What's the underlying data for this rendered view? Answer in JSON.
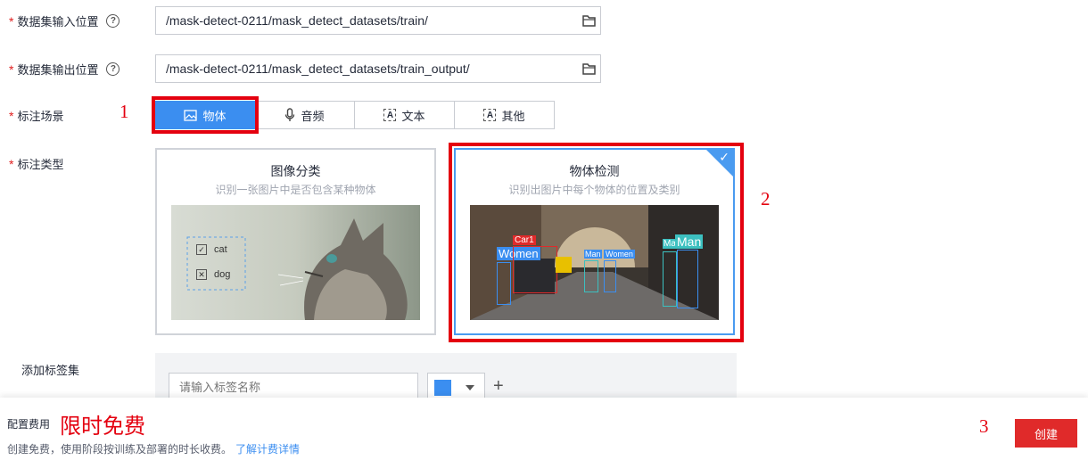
{
  "form": {
    "input_location": {
      "required_mark": "*",
      "label": "数据集输入位置",
      "help_icon": "question-circle-icon",
      "value": "/mask-detect-0211/mask_detect_datasets/train/",
      "icon": "folder-icon"
    },
    "output_location": {
      "required_mark": "*",
      "label": "数据集输出位置",
      "help_icon": "question-circle-icon",
      "value": "/mask-detect-0211/mask_detect_datasets/train_output/",
      "icon": "folder-icon"
    },
    "scene": {
      "required_mark": "*",
      "label": "标注场景",
      "options": [
        {
          "label": "物体",
          "icon": "image-icon",
          "selected": true
        },
        {
          "label": "音频",
          "icon": "microphone-icon",
          "selected": false
        },
        {
          "label": "文本",
          "icon": "text-icon",
          "selected": false
        },
        {
          "label": "其他",
          "icon": "text-icon",
          "selected": false
        }
      ]
    },
    "type": {
      "required_mark": "*",
      "label": "标注类型",
      "cards": [
        {
          "title": "图像分类",
          "subtitle": "识别一张图片中是否包含某种物体",
          "selected": false,
          "labels": [
            {
              "text": "cat",
              "checked": true
            },
            {
              "text": "dog",
              "checked": false
            }
          ]
        },
        {
          "title": "物体检测",
          "subtitle": "识别出图片中每个物体的位置及类别",
          "selected": true,
          "boxes": [
            "Car1",
            "Women",
            "Man",
            "Women",
            "Ma",
            "Man"
          ]
        }
      ]
    },
    "tags": {
      "label": "添加标签集",
      "input_placeholder": "请输入标签名称",
      "color": "#3b8ef0",
      "add_symbol": "+"
    }
  },
  "annotations": {
    "mark1": "1",
    "mark2": "2",
    "mark3": "3",
    "color": "#e4000f"
  },
  "footer": {
    "fee_label": "配置费用",
    "fee_value": "限时免费",
    "note": "创建免费，使用阶段按训练及部署的时长收费。",
    "link": "了解计费详情",
    "create_button": "创建"
  }
}
